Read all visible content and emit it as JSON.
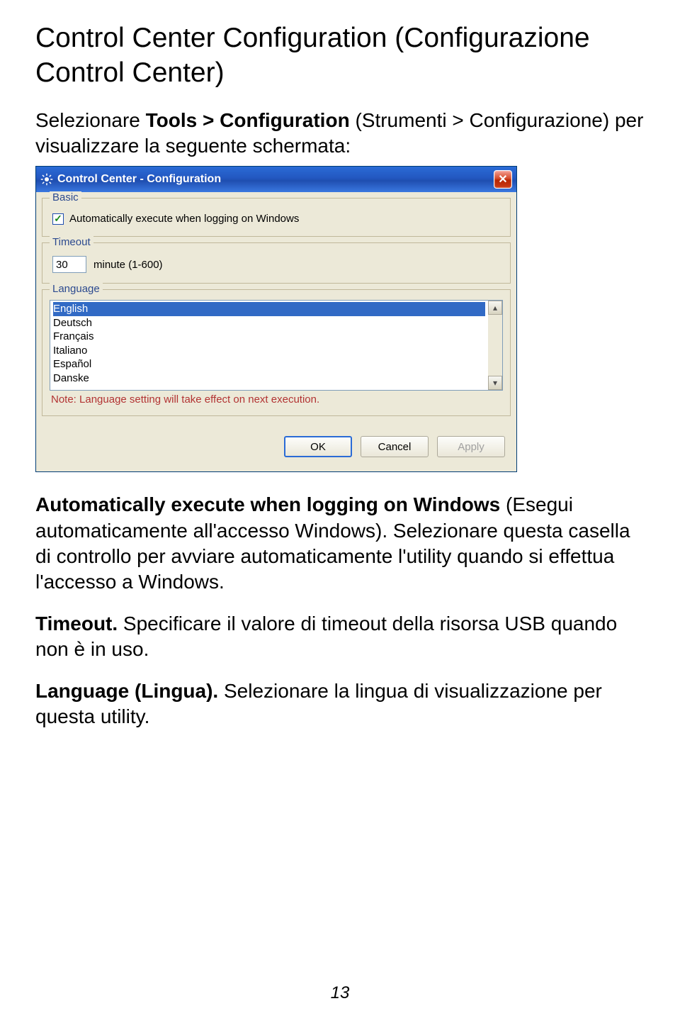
{
  "doc": {
    "title": "Control Center Configuration (Configurazione Control Center)",
    "intro_prefix": "Selezionare ",
    "intro_bold": "Tools > Configuration",
    "intro_suffix": " (Strumenti > Configurazione) per visualizzare la seguente schermata:",
    "p1_bold": "Automatically execute when logging on Windows",
    "p1_rest": " (Esegui automaticamente all'accesso Windows). Selezionare questa casella di controllo per avviare automaticamente l'utility quando si effettua l'accesso a Windows.",
    "p2_bold": "Timeout.",
    "p2_rest": " Specificare il valore di timeout della risorsa USB quando non è in uso.",
    "p3_bold": "Language (Lingua).",
    "p3_rest": " Selezionare la lingua di visualizzazione per questa utility.",
    "page_number": "13"
  },
  "dialog": {
    "title": "Control Center  -  Configuration",
    "groups": {
      "basic": {
        "legend": "Basic",
        "checkbox_label": "Automatically execute when logging on Windows",
        "checked_glyph": "✓"
      },
      "timeout": {
        "legend": "Timeout",
        "value": "30",
        "unit": "minute (1-600)"
      },
      "language": {
        "legend": "Language",
        "items": [
          "English",
          "Deutsch",
          "Français",
          "Italiano",
          "Español",
          "Danske"
        ],
        "note": "Note: Language setting will take effect on next execution.",
        "scroll_up": "▴",
        "scroll_down": "▾"
      }
    },
    "buttons": {
      "ok": "OK",
      "cancel": "Cancel",
      "apply": "Apply"
    },
    "close_glyph": "✕"
  }
}
